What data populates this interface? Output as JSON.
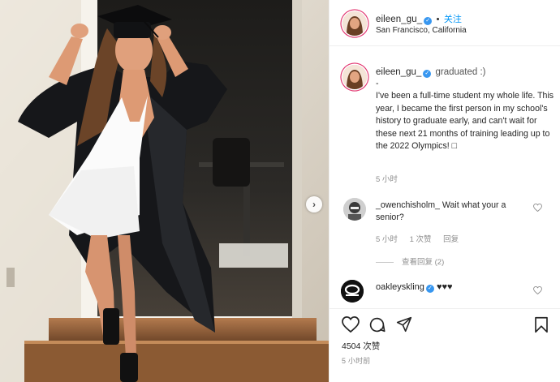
{
  "post": {
    "author": "eileen_gu_",
    "follow_label": "关注",
    "separator": "•",
    "location": "San Francisco, California",
    "more_icon": "more-horizontal-icon"
  },
  "caption": {
    "username": "eileen_gu_",
    "action": "graduated :)",
    "text": "-\nI've been a full-time student my whole life. This year, I became the first person in my school's history to graduate early, and can't wait for these next 21 months of training leading up to the 2022 Olympics! □",
    "time": "5 小时"
  },
  "comments": [
    {
      "username": "_owenchisholm_",
      "text": "Wait what your a senior?",
      "time": "5 小时",
      "likes": "1 次赞",
      "reply": "回复",
      "view_replies": "查看回复 (2)"
    },
    {
      "username": "oakleyskling",
      "text": "♥♥♥"
    }
  ],
  "actions": {
    "like_icon": "heart-icon",
    "comment_icon": "comment-icon",
    "share_icon": "send-icon",
    "save_icon": "bookmark-icon"
  },
  "likes_count": "4504 次赞",
  "post_time": "5 小时前",
  "carousel": {
    "next_icon": "chevron-right-icon",
    "next_glyph": "›"
  },
  "colors": {
    "link": "#0095f6",
    "verified": "#3897f0",
    "muted": "#8e8e8e",
    "text": "#262626"
  }
}
